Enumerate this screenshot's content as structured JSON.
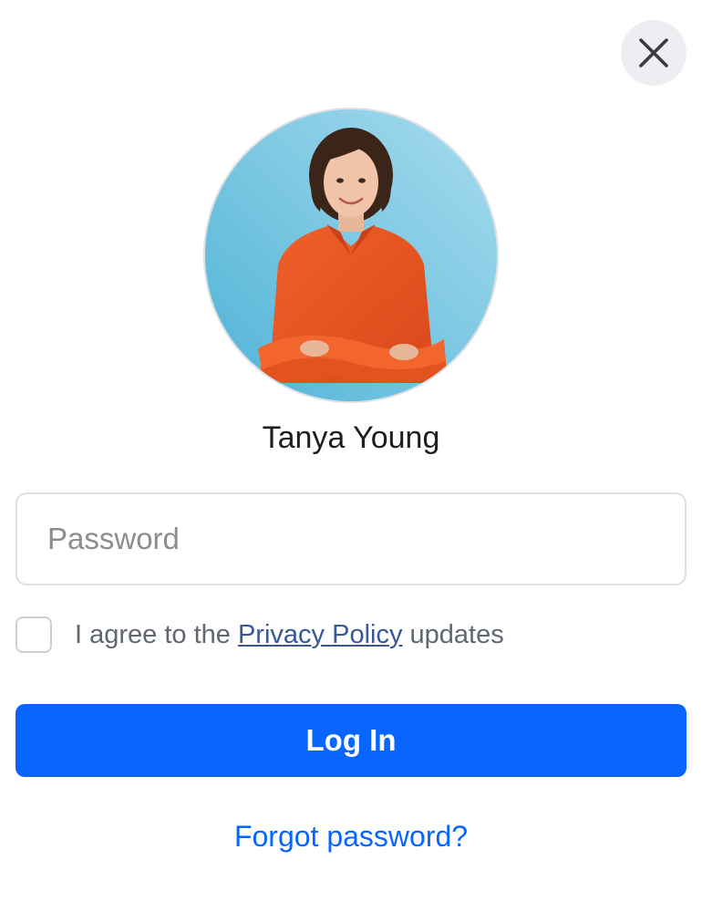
{
  "header": {
    "close_icon": "close-icon"
  },
  "profile": {
    "name": "Tanya Young",
    "avatar_icon": "profile-photo"
  },
  "form": {
    "password_placeholder": "Password",
    "password_value": "",
    "agree_prefix": "I agree to the ",
    "agree_link": "Privacy Policy",
    "agree_suffix": " updates",
    "agree_checked": false,
    "login_label": "Log In",
    "forgot_label": "Forgot password?"
  },
  "colors": {
    "primary": "#0866ff",
    "link": "#385898",
    "close_bg": "#eceef1"
  }
}
